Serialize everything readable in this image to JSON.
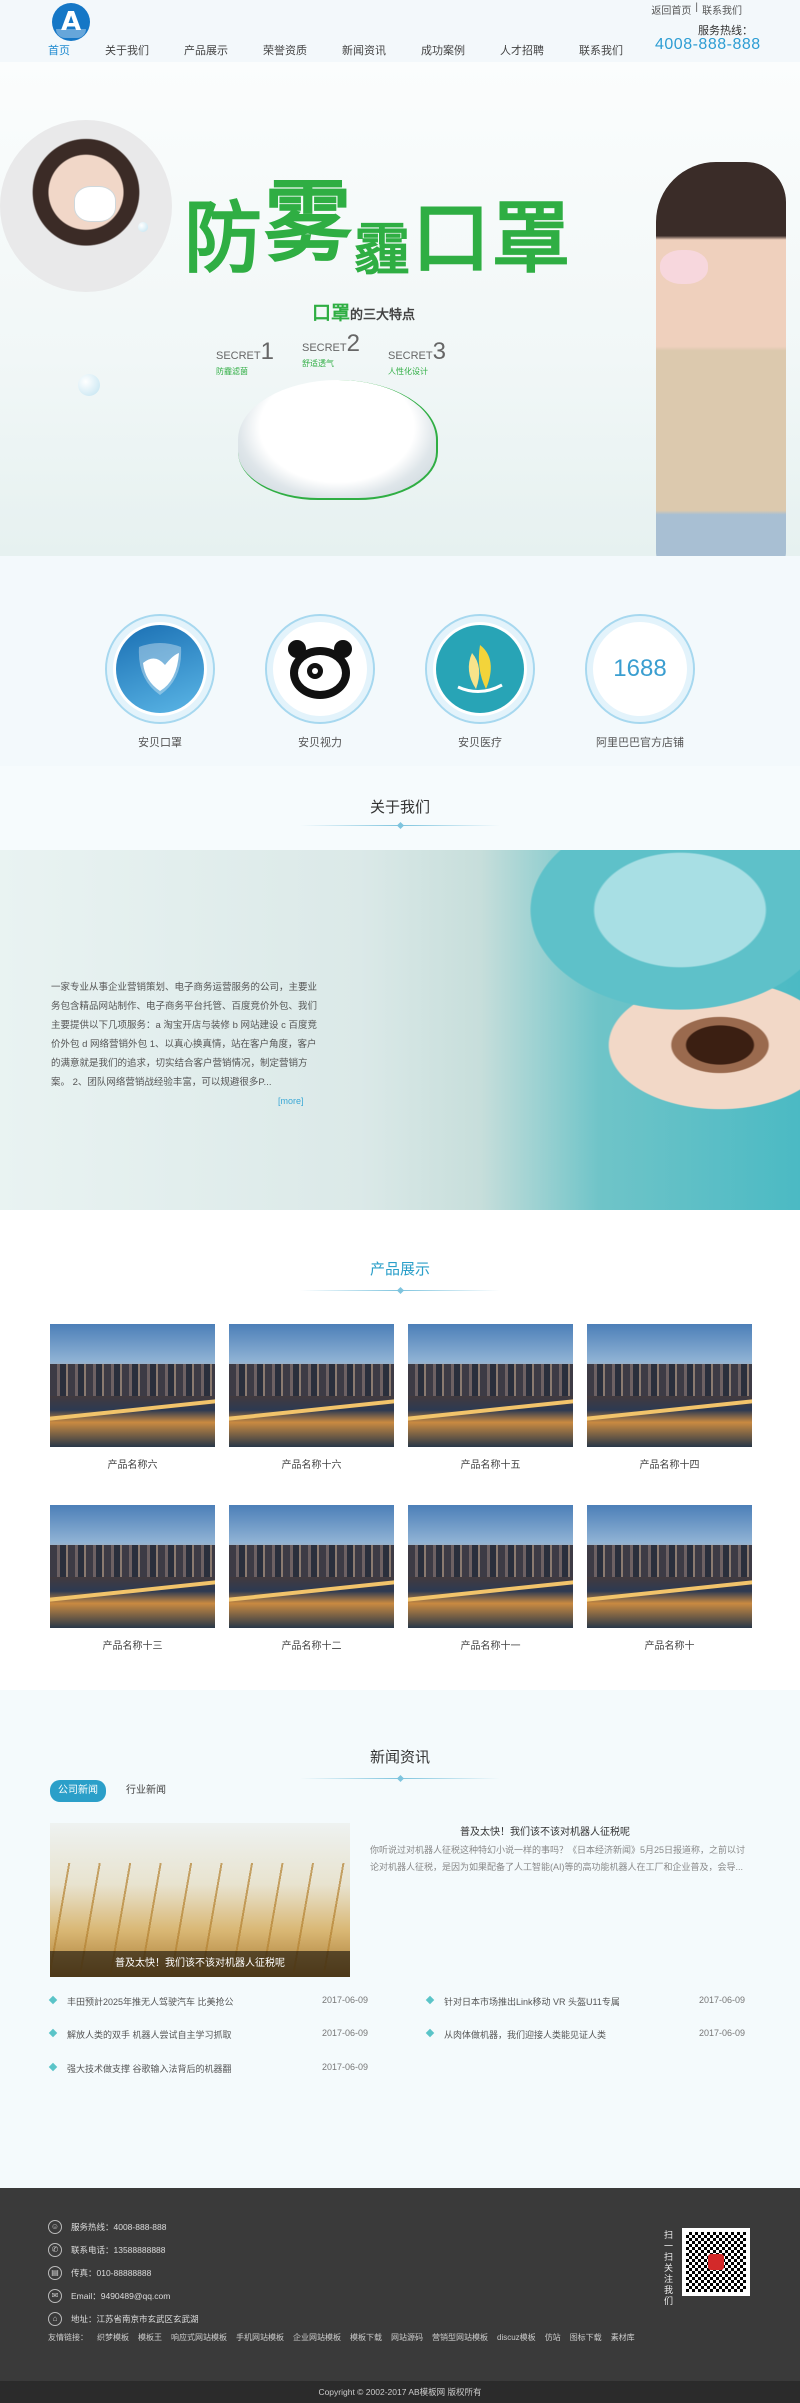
{
  "header": {
    "logo_letter": "A",
    "nav": [
      "首页",
      "关于我们",
      "产品展示",
      "荣誉资质",
      "新闻资讯",
      "成功案例",
      "人才招聘",
      "联系我们"
    ],
    "top_links": [
      "返回首页",
      "|",
      "联系我们"
    ],
    "hotline_label": "服务热线：",
    "hotline": "4008-888-888"
  },
  "banner": {
    "title_a": "防",
    "title_b": "雾",
    "title_c": "霾",
    "title_d": "口罩",
    "subtitle_main": "口罩",
    "subtitle_rest": "的三大特点",
    "secrets": [
      {
        "label": "SECRET",
        "num": "1",
        "text": "防霾滤菌"
      },
      {
        "label": "SECRET",
        "num": "2",
        "text": "舒适透气"
      },
      {
        "label": "SECRET",
        "num": "3",
        "text": "人性化设计"
      }
    ]
  },
  "brands": [
    {
      "name": "安贝口罩",
      "icon": "shield-icon"
    },
    {
      "name": "安贝视力",
      "icon": "panda-icon"
    },
    {
      "name": "安贝医疗",
      "icon": "sail-icon"
    },
    {
      "name": "阿里巴巴官方店铺",
      "icon": "1688-icon",
      "icon_text": "1688"
    }
  ],
  "about": {
    "title": "关于我们",
    "text": "一家专业从事企业营销策划、电子商务运营服务的公司，主要业务包含精品网站制作、电子商务平台托管、百度竞价外包、我们主要提供以下几项服务：a 淘宝开店与装修 b 网站建设 c 百度竞价外包 d 网络营销外包 1、以真心换真情，站在客户角度，客户的满意就是我们的追求，切实结合客户营销情况，制定营销方案。 2、团队网络营销战经验丰富，可以规避很多P...",
    "more": "[more]"
  },
  "products": {
    "title": "产品展示",
    "items": [
      "产品名称六",
      "产品名称十六",
      "产品名称十五",
      "产品名称十四",
      "产品名称十三",
      "产品名称十二",
      "产品名称十一",
      "产品名称十"
    ]
  },
  "news": {
    "title": "新闻资讯",
    "tabs": [
      "公司新闻",
      "行业新闻"
    ],
    "image_caption": "普及太快！我们该不该对机器人征税呢",
    "featured_title": "普及太快！我们该不该对机器人征税呢",
    "featured_body": "你听说过对机器人征税这种特幻小说一样的事吗？《日本经济新闻》5月25日报道称，之前以讨论对机器人征税，是因为如果配备了人工智能(AI)等的高功能机器人在工厂和企业普及，会导...",
    "left_list": [
      {
        "title": "丰田预計2025年推无人驾驶汽车 比美抢公",
        "date": "2017-06-09"
      },
      {
        "title": "解放人类的双手 机器人尝试自主学习抓取",
        "date": "2017-06-09"
      },
      {
        "title": "强大技术做支撑 谷歌输入法背后的机器翻",
        "date": "2017-06-09"
      }
    ],
    "right_list": [
      {
        "title": "针对日本市场推出Link移动 VR 头盔U11专属",
        "date": "2017-06-09"
      },
      {
        "title": "从肉体做机器，我们迎接人类能见证人类",
        "date": "2017-06-09"
      }
    ]
  },
  "footer": {
    "lines": [
      {
        "icon": "user-icon",
        "text": "服务热线：4008-888-888"
      },
      {
        "icon": "phone-icon",
        "text": "联系电话：13588888888"
      },
      {
        "icon": "fax-icon",
        "text": "传真：010-88888888"
      },
      {
        "icon": "mail-icon",
        "text": "Email：9490489@qq.com"
      },
      {
        "icon": "location-icon",
        "text": "地址：江苏省南京市玄武区玄武湖"
      }
    ],
    "qr_label": "扫一扫关注我们",
    "links_label": "友情链接：",
    "links": [
      "织梦模板",
      "模板王",
      "响应式网站模板",
      "手机网站模板",
      "企业网站模板",
      "模板下载",
      "网站源码",
      "营销型网站模板",
      "discuz模板",
      "仿站",
      "图标下载",
      "素材库"
    ],
    "copyright": "Copyright © 2002-2017 AB模板网 版权所有"
  },
  "colors": {
    "accent": "#2b9fc9",
    "brand_green": "#2fae43",
    "footer_bg": "#3a3a3a"
  }
}
